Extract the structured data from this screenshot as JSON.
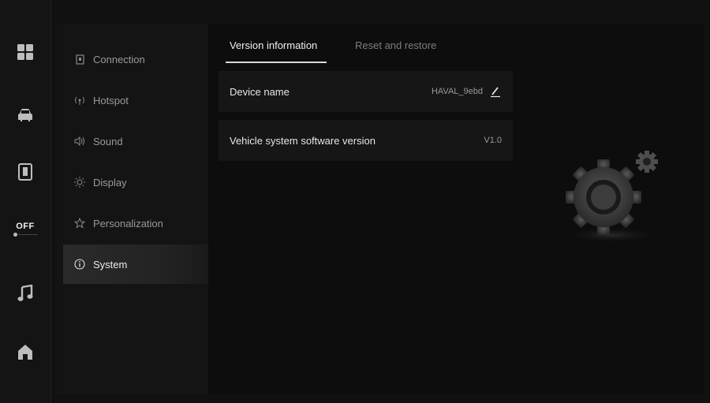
{
  "dock": {
    "climate": {
      "status": "OFF"
    }
  },
  "sidebar": {
    "items": [
      {
        "label": "Connection",
        "icon": "connection-icon",
        "active": false
      },
      {
        "label": "Hotspot",
        "icon": "hotspot-icon",
        "active": false
      },
      {
        "label": "Sound",
        "icon": "sound-icon",
        "active": false
      },
      {
        "label": "Display",
        "icon": "display-icon",
        "active": false
      },
      {
        "label": "Personalization",
        "icon": "personalization-icon",
        "active": false
      },
      {
        "label": "System",
        "icon": "info-icon",
        "active": true
      }
    ]
  },
  "tabs": [
    {
      "label": "Version information",
      "active": true
    },
    {
      "label": "Reset and restore",
      "active": false
    }
  ],
  "rows": {
    "device_name": {
      "label": "Device name",
      "value": "HAVAL_9ebd"
    },
    "software_version": {
      "label": "Vehicle system software version",
      "value": "V1.0"
    }
  },
  "colors": {
    "background": "#0b0b0b",
    "panel": "#141414",
    "accent": "#d8d8d8"
  }
}
